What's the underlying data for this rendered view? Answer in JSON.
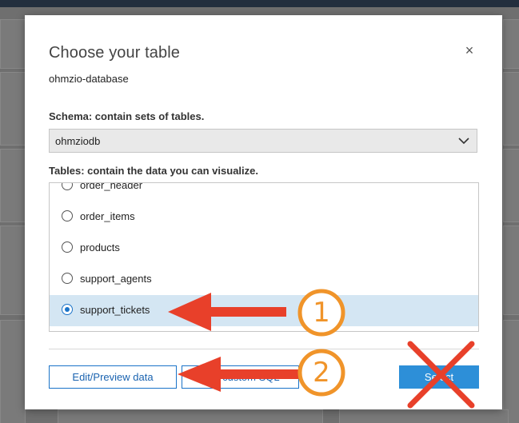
{
  "modal": {
    "title": "Choose your table",
    "database_name": "ohmzio-database",
    "close_label": "×"
  },
  "schema": {
    "label": "Schema: contain sets of tables.",
    "selected": "ohmziodb"
  },
  "tables": {
    "label": "Tables: contain the data you can visualize.",
    "items": [
      {
        "name": "order_header",
        "selected": false
      },
      {
        "name": "order_items",
        "selected": false
      },
      {
        "name": "products",
        "selected": false
      },
      {
        "name": "support_agents",
        "selected": false
      },
      {
        "name": "support_tickets",
        "selected": true
      }
    ]
  },
  "buttons": {
    "edit_preview": "Edit/Preview data",
    "custom_sql": "Use custom SQL",
    "select": "Select"
  },
  "annotations": {
    "step1": "1",
    "step2": "2",
    "arrow_color": "#e8402a",
    "circle_color": "#f0942a",
    "cross_color": "#e8402a"
  }
}
